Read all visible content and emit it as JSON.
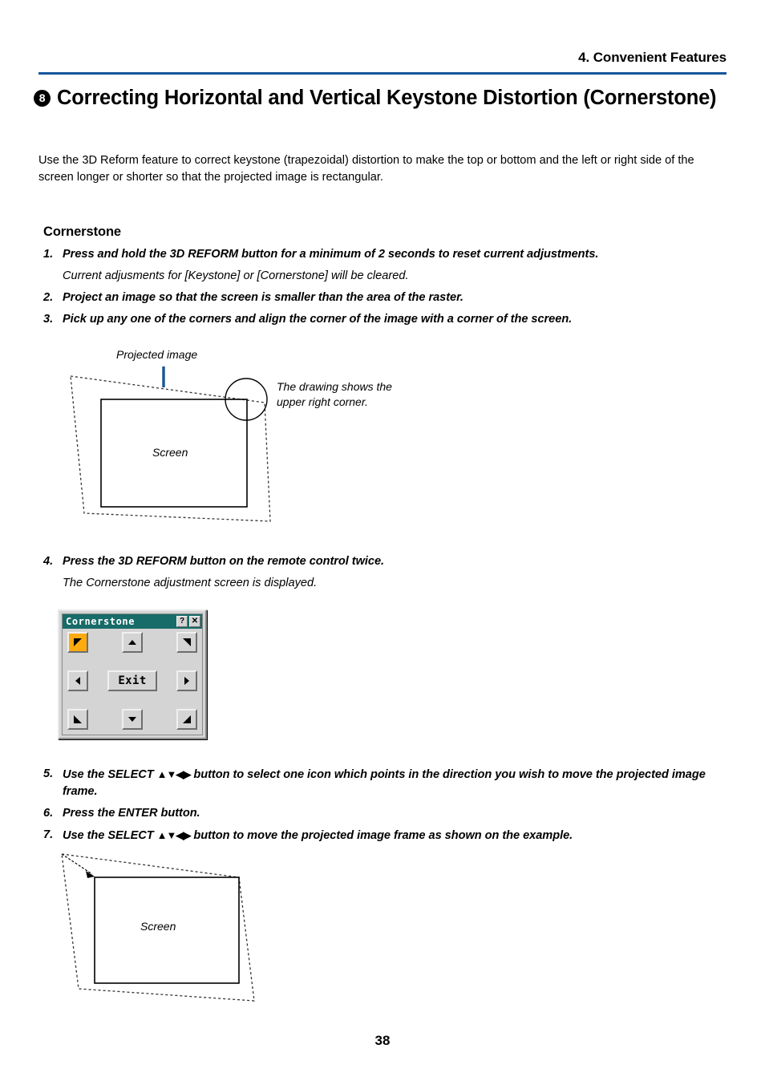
{
  "header": {
    "chapter": "4. Convenient Features",
    "rule_color": "#15559a"
  },
  "section": {
    "number": "8",
    "title": "Correcting Horizontal and Vertical Keystone Distortion (Cornerstone)"
  },
  "intro": "Use the 3D Reform feature to correct keystone (trapezoidal) distortion to make the top or bottom and the left or right side of the screen longer or shorter so that the projected image is rectangular.",
  "subheading": "Cornerstone",
  "steps": [
    {
      "num": "1.",
      "text": "Press and hold the 3D REFORM button for a minimum of 2 seconds to reset current adjustments.",
      "note": "Current adjusments for [Keystone] or [Cornerstone] will be cleared."
    },
    {
      "num": "2.",
      "text": "Project an image so that the screen is smaller than the area of the raster.",
      "note": ""
    },
    {
      "num": "3.",
      "text": "Pick up any one of the corners and align the corner of the image with a corner of the screen.",
      "note": ""
    },
    {
      "num": "4.",
      "text": "Press the 3D REFORM button on the remote control twice.",
      "note": "The Cornerstone adjustment screen is displayed."
    },
    {
      "num": "5.",
      "text_before": "Use the SELECT ",
      "arrows": "▲▼◀▶",
      "text_after": " button to select one icon which points in the direction you wish to move the projected image frame.",
      "note": ""
    },
    {
      "num": "6.",
      "text": "Press the ENTER button.",
      "note": ""
    },
    {
      "num": "7.",
      "text_before": "Use the SELECT ",
      "arrows": "▲▼◀▶",
      "text_after": " button to move the projected image frame as shown on the example.",
      "note": ""
    }
  ],
  "diagram1": {
    "label_projected": "Projected image",
    "label_note": "The drawing shows the\nupper right corner.",
    "label_screen": "Screen",
    "pointer_color": "#1a5490"
  },
  "diagram2": {
    "label_screen": "Screen"
  },
  "dialog": {
    "title": "Cornerstone",
    "title_bg": "#176b68",
    "help_button": "?",
    "close_button": "✕",
    "exit_label": "Exit",
    "selected_button": "up-left",
    "selected_color": "#ffab10",
    "buttons": [
      {
        "name": "up-left",
        "icon": "arrow-up-left-icon"
      },
      {
        "name": "up",
        "icon": "arrow-up-icon"
      },
      {
        "name": "up-right",
        "icon": "arrow-up-right-icon"
      },
      {
        "name": "left",
        "icon": "arrow-left-icon"
      },
      {
        "name": "right",
        "icon": "arrow-right-icon"
      },
      {
        "name": "down-left",
        "icon": "arrow-down-left-icon"
      },
      {
        "name": "down",
        "icon": "arrow-down-icon"
      },
      {
        "name": "down-right",
        "icon": "arrow-down-right-icon"
      }
    ]
  },
  "page_number": "38"
}
